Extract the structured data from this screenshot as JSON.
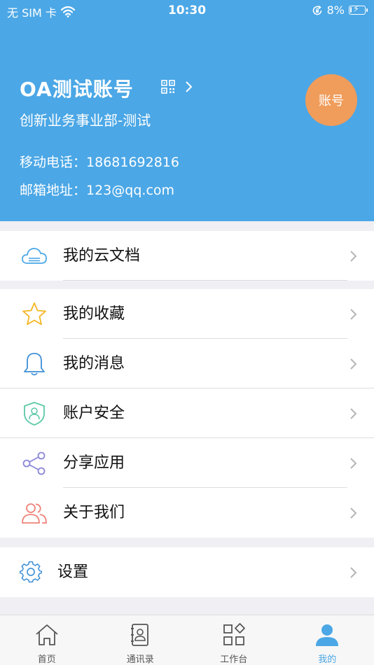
{
  "status_bar": {
    "carrier": "无 SIM 卡",
    "time": "10:30",
    "battery": "8%",
    "battery_level": 0.08
  },
  "profile": {
    "name": "OA测试账号",
    "department": "创新业务事业部-测试",
    "phone_label": "移动电话：",
    "phone": "18681692816",
    "email_label": "邮箱地址：",
    "email": "123@qq.com",
    "avatar_text": "账号",
    "avatar_color": "#f09c5b"
  },
  "menu": {
    "cloud_docs": "我的云文档",
    "favorites": "我的收藏",
    "messages": "我的消息",
    "account_security": "账户安全",
    "share_app": "分享应用",
    "about_us": "关于我们",
    "settings": "设置"
  },
  "tabbar": {
    "home": "首页",
    "contacts": "通讯录",
    "workbench": "工作台",
    "mine": "我的"
  },
  "colors": {
    "header_bg": "#4ba7e6",
    "active_tab": "#4ba7e6"
  }
}
